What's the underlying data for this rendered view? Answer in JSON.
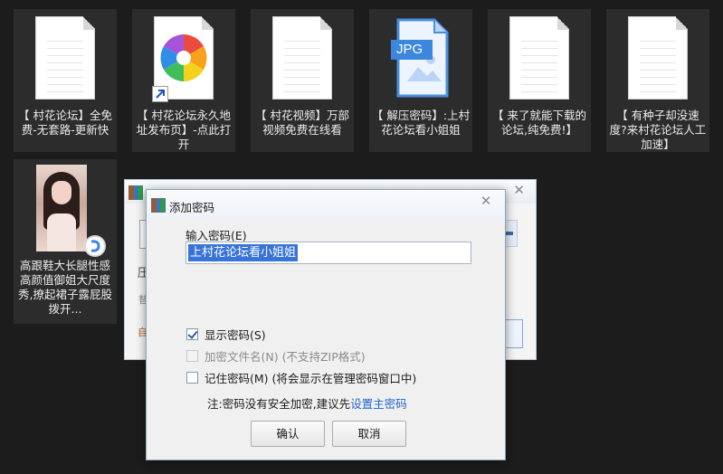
{
  "desktop": {
    "files": [
      {
        "label": "【 村花论坛】全免费-无套路-更新快",
        "icon": "text-document-icon"
      },
      {
        "label": "【 村花论坛永久地址发布页】-点此打开",
        "icon": "shortcut-pinwheel-icon"
      },
      {
        "label": "【 村花视频】万部视频免费在线看",
        "icon": "text-document-icon"
      },
      {
        "label": "【 解压密码】:上村花论坛看小姐姐",
        "icon": "jpg-image-icon",
        "badge": "JPG"
      },
      {
        "label": "【 来了就能下载的论坛,纯免费!】",
        "icon": "text-document-icon"
      },
      {
        "label": "【 有种子却没速度?来村花论坛人工加速】",
        "icon": "text-document-icon"
      },
      {
        "label": "高跟鞋大长腿性感高颜值御姐大尺度秀,撩起裙子露屁股拨开...",
        "icon": "photo-thumbnail-icon"
      }
    ]
  },
  "background_window": {
    "close_glyph": "✕",
    "fragments": [
      "压",
      "替",
      "自"
    ]
  },
  "dialog": {
    "title": "添加密码",
    "close_glyph": "✕",
    "input_label": "输入密码(E)",
    "password_value": "上村花论坛看小姐姐",
    "options": [
      {
        "label": "显示密码(S)",
        "checked": true,
        "enabled": true
      },
      {
        "label": "加密文件名(N) (不支持ZIP格式)",
        "checked": false,
        "enabled": false
      },
      {
        "label": "记住密码(M) (将会显示在管理密码窗口中)",
        "checked": false,
        "enabled": true
      }
    ],
    "note_prefix": "注:密码没有安全加密,建议先",
    "note_link": "设置主密码",
    "ok_label": "确认",
    "cancel_label": "取消"
  },
  "colors": {
    "desktop_bg": "#1c1c1c",
    "tile_bg": "#2c2c2c",
    "selection": "#3874d8",
    "link": "#1f63c8"
  }
}
